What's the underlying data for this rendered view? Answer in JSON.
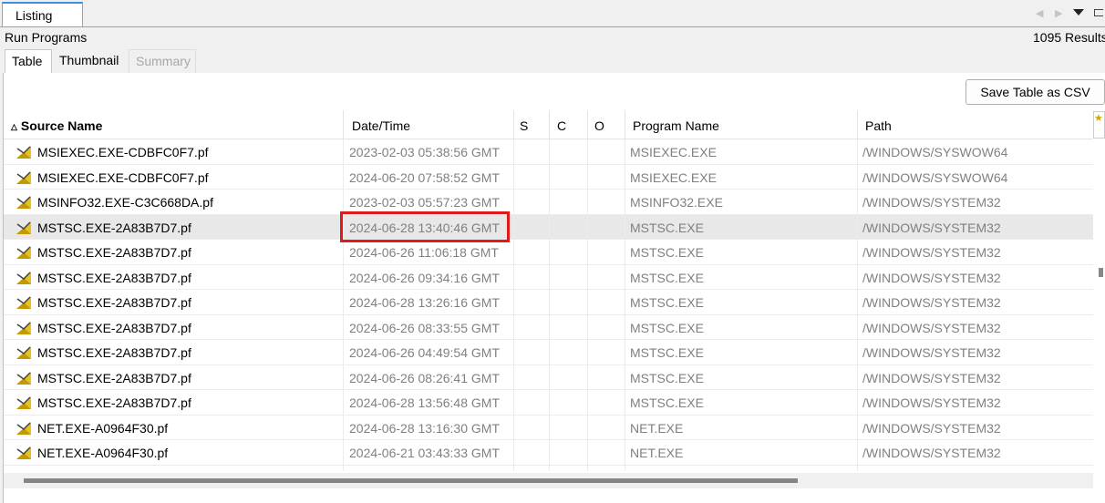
{
  "top_tab": {
    "label": "Listing"
  },
  "panel": {
    "title": "Run Programs",
    "results": "1095  Results"
  },
  "subtabs": [
    {
      "label": "Table",
      "state": "active"
    },
    {
      "label": "Thumbnail",
      "state": "normal"
    },
    {
      "label": "Summary",
      "state": "disabled"
    }
  ],
  "toolbar": {
    "save_csv_label": "Save Table as CSV"
  },
  "table": {
    "columns": [
      "Source Name",
      "Date/Time",
      "S",
      "C",
      "O",
      "Program Name",
      "Path"
    ],
    "sorted_column": "Source Name",
    "selected_row": 3,
    "rows": [
      [
        "MSIEXEC.EXE-CDBFC0F7.pf",
        "2023-02-03 05:38:56 GMT",
        "",
        "",
        "",
        "MSIEXEC.EXE",
        "/WINDOWS/SYSWOW64"
      ],
      [
        "MSIEXEC.EXE-CDBFC0F7.pf",
        "2024-06-20 07:58:52 GMT",
        "",
        "",
        "",
        "MSIEXEC.EXE",
        "/WINDOWS/SYSWOW64"
      ],
      [
        "MSINFO32.EXE-C3C668DA.pf",
        "2023-02-03 05:57:23 GMT",
        "",
        "",
        "",
        "MSINFO32.EXE",
        "/WINDOWS/SYSTEM32"
      ],
      [
        "MSTSC.EXE-2A83B7D7.pf",
        "2024-06-28 13:40:46 GMT",
        "",
        "",
        "",
        "MSTSC.EXE",
        "/WINDOWS/SYSTEM32"
      ],
      [
        "MSTSC.EXE-2A83B7D7.pf",
        "2024-06-26 11:06:18 GMT",
        "",
        "",
        "",
        "MSTSC.EXE",
        "/WINDOWS/SYSTEM32"
      ],
      [
        "MSTSC.EXE-2A83B7D7.pf",
        "2024-06-26 09:34:16 GMT",
        "",
        "",
        "",
        "MSTSC.EXE",
        "/WINDOWS/SYSTEM32"
      ],
      [
        "MSTSC.EXE-2A83B7D7.pf",
        "2024-06-28 13:26:16 GMT",
        "",
        "",
        "",
        "MSTSC.EXE",
        "/WINDOWS/SYSTEM32"
      ],
      [
        "MSTSC.EXE-2A83B7D7.pf",
        "2024-06-26 08:33:55 GMT",
        "",
        "",
        "",
        "MSTSC.EXE",
        "/WINDOWS/SYSTEM32"
      ],
      [
        "MSTSC.EXE-2A83B7D7.pf",
        "2024-06-26 04:49:54 GMT",
        "",
        "",
        "",
        "MSTSC.EXE",
        "/WINDOWS/SYSTEM32"
      ],
      [
        "MSTSC.EXE-2A83B7D7.pf",
        "2024-06-26 08:26:41 GMT",
        "",
        "",
        "",
        "MSTSC.EXE",
        "/WINDOWS/SYSTEM32"
      ],
      [
        "MSTSC.EXE-2A83B7D7.pf",
        "2024-06-28 13:56:48 GMT",
        "",
        "",
        "",
        "MSTSC.EXE",
        "/WINDOWS/SYSTEM32"
      ],
      [
        "NET.EXE-A0964F30.pf",
        "2024-06-28 13:16:30 GMT",
        "",
        "",
        "",
        "NET.EXE",
        "/WINDOWS/SYSTEM32"
      ],
      [
        "NET.EXE-A0964F30.pf",
        "2024-06-21 03:43:33 GMT",
        "",
        "",
        "",
        "NET.EXE",
        "/WINDOWS/SYSTEM32"
      ]
    ]
  },
  "colors": {
    "highlight_box": "#e01a1a",
    "active_tab_accent": "#3c8fde",
    "muted_text": "#808080"
  },
  "icons": {
    "row_icon": "prefetch-file-icon",
    "sort": "sort-ascending-icon"
  }
}
